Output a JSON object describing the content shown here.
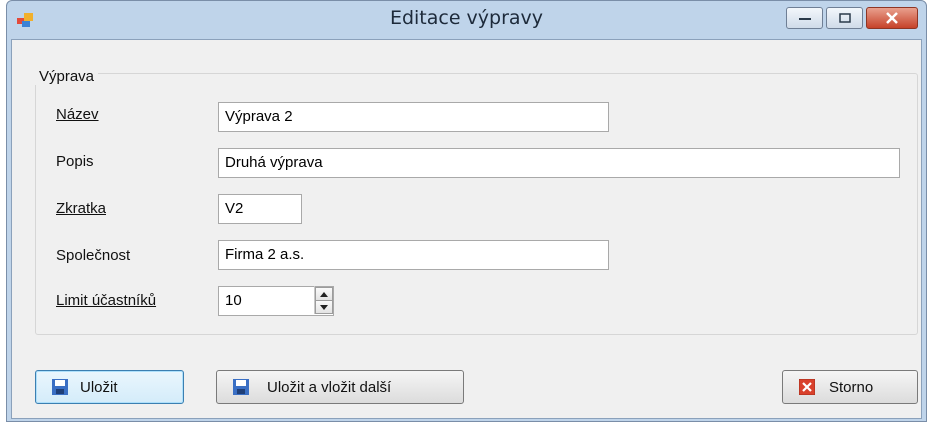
{
  "window": {
    "title": "Editace výpravy"
  },
  "group": {
    "legend": "Výprava"
  },
  "fields": {
    "nazev": {
      "label": "Název",
      "value": "Výprava 2"
    },
    "popis": {
      "label": "Popis",
      "value": "Druhá výprava"
    },
    "zkratka": {
      "label": "Zkratka",
      "value": "V2"
    },
    "spolecnost": {
      "label": "Společnost",
      "value": "Firma 2 a.s."
    },
    "limit": {
      "label": "Limit účastníků",
      "value": "10"
    }
  },
  "buttons": {
    "save": "Uložit",
    "save_next": "Uložit a vložit další",
    "cancel": "Storno"
  },
  "colors": {
    "accent": "#3c7fb1",
    "close": "#c6422a"
  }
}
